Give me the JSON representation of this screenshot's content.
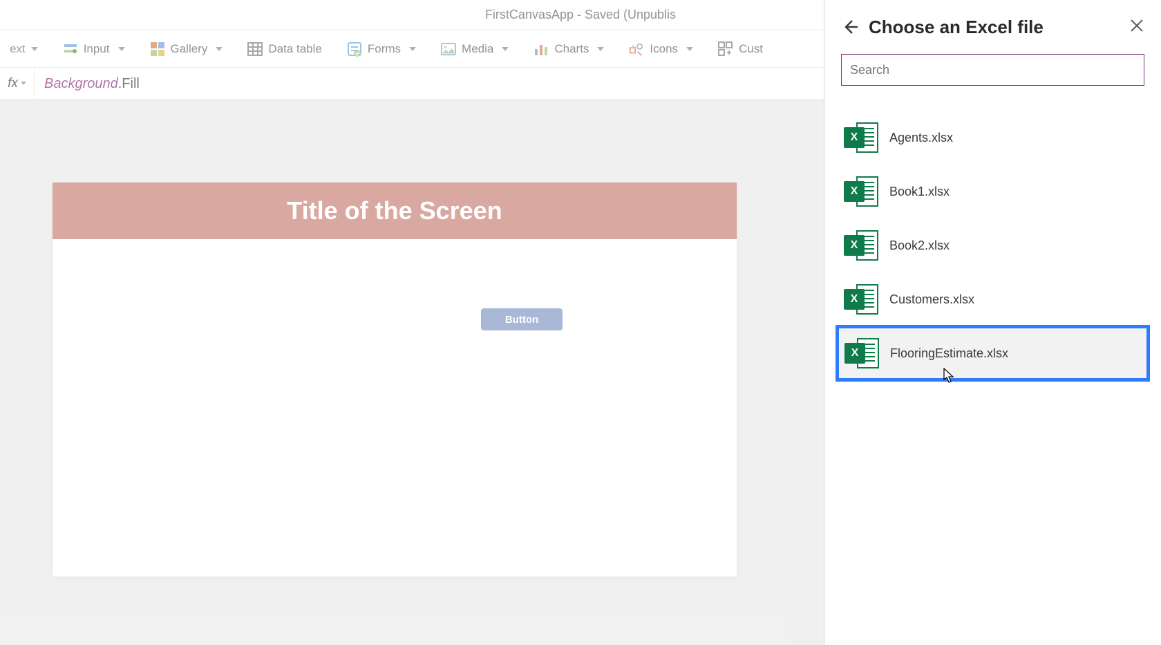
{
  "titlebar": {
    "text": "FirstCanvasApp - Saved (Unpublis"
  },
  "ribbon": {
    "text_partial": "ext",
    "input": "Input",
    "gallery": "Gallery",
    "data_table": "Data table",
    "forms": "Forms",
    "media": "Media",
    "charts": "Charts",
    "icons": "Icons",
    "custom_partial": "Cust"
  },
  "formula": {
    "fx": "fx",
    "ident": "Background",
    "prop": ".Fill"
  },
  "canvas": {
    "screen_title": "Title of the Screen",
    "button_label": "Button"
  },
  "panel": {
    "title": "Choose an Excel file",
    "search_placeholder": "Search",
    "files": [
      {
        "name": "Agents.xlsx"
      },
      {
        "name": "Book1.xlsx"
      },
      {
        "name": "Book2.xlsx"
      },
      {
        "name": "Customers.xlsx"
      },
      {
        "name": "FlooringEstimate.xlsx",
        "highlighted": true
      }
    ]
  }
}
